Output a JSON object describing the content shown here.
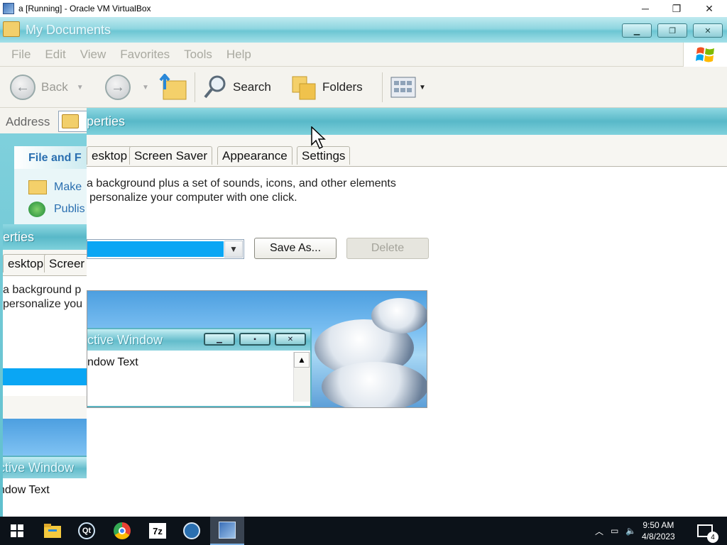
{
  "host": {
    "title": "a [Running] - Oracle VM VirtualBox",
    "controls": {
      "minimize": "─",
      "restore": "❐",
      "close": "✕"
    }
  },
  "explorer": {
    "title": "My Documents",
    "menu": [
      "File",
      "Edit",
      "View",
      "Favorites",
      "Tools",
      "Help"
    ],
    "toolbar": {
      "back": "Back",
      "search": "Search",
      "folders": "Folders"
    },
    "address_label": "Address",
    "taskpane": {
      "header": "File and F",
      "items": [
        "Make",
        "Publis"
      ]
    }
  },
  "display_props_front": {
    "title": "perties",
    "tabs": [
      "esktop",
      "Screen Saver",
      "Appearance",
      "Settings"
    ],
    "description_line1": "a background plus a set of sounds, icons, and other elements",
    "description_line2": "personalize your computer with one click.",
    "save_as_label": "Save As...",
    "delete_label": "Delete",
    "preview": {
      "window_title": "ctive Window",
      "window_text": "ndow Text"
    }
  },
  "display_props_back": {
    "title": "erties",
    "tabs": [
      "esktop",
      "Screer"
    ],
    "description_line1": "a background p",
    "description_line2": "personalize you",
    "preview": {
      "window_title": "ctive Window",
      "window_text": "ndow Text"
    }
  },
  "taskbar": {
    "apps": [
      "windows-start",
      "file-explorer",
      "qt-app",
      "chrome",
      "7zip",
      "network-app",
      "virtualbox"
    ],
    "seven_zip_label": "7z",
    "time": "9:50 AM",
    "date": "4/8/2023",
    "notification_count": "4"
  },
  "colors": {
    "xp_title": "#6cc6d3",
    "selection_blue": "#0aa6f4",
    "taskbar": "#0c1219"
  }
}
